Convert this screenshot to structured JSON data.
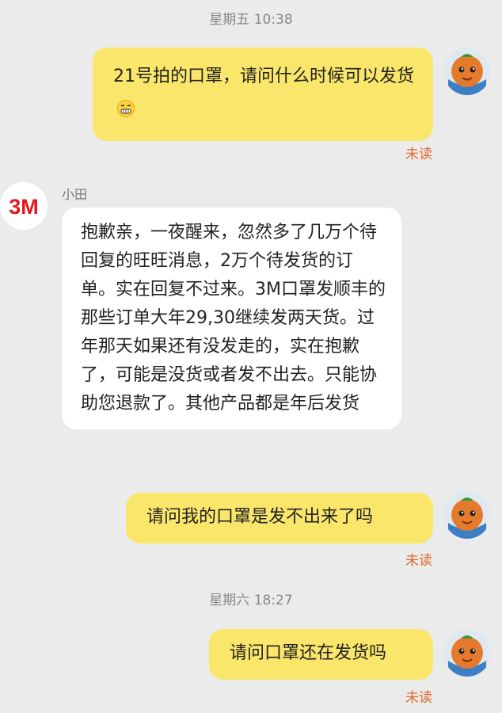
{
  "messages": [
    {
      "timestamp": "星期五 10:38"
    },
    {
      "outgoing_1": "21号拍的口罩，请问什么时候可以发货",
      "status": "未读"
    },
    {
      "sender": "小田",
      "incoming_1": "抱歉亲，一夜醒来，忽然多了几万个待回复的旺旺消息，2万个待发货的订单。实在回复不过来。3M口罩发顺丰的那些订单大年29,30继续发两天货。过年那天如果还有没发走的，实在抱歉了，可能是没货或者发不出去。只能协助您退款了。其他产品都是年后发货"
    },
    {
      "outgoing_2": "请问我的口罩是发不出来了吗",
      "status": "未读"
    },
    {
      "timestamp": "星期六 18:27"
    },
    {
      "outgoing_3": "请问口罩还在发货吗",
      "status": "未读"
    }
  ],
  "contact": {
    "logo_text": "3M",
    "brand_color": "#e0191e"
  },
  "colors": {
    "outgoing_bubble": "#f9e66a",
    "incoming_bubble": "#ffffff",
    "unread": "#e0682b",
    "background": "#ebebeb"
  },
  "icons": {
    "emoji": "grimace-emoji-icon",
    "user_avatar": "orange-cartoon-avatar-icon"
  }
}
